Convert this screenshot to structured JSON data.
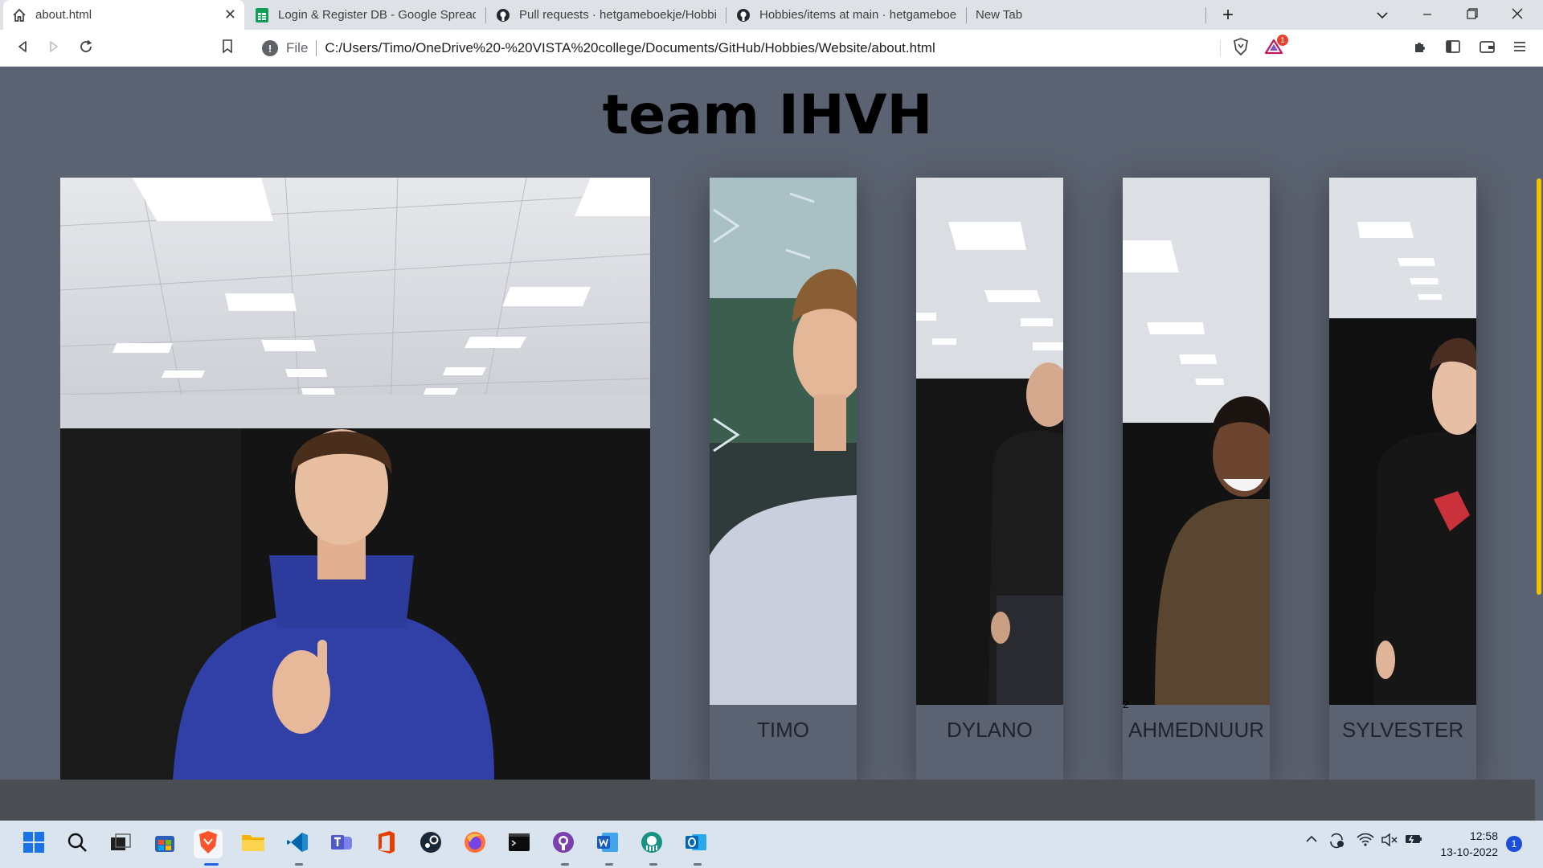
{
  "browser": {
    "tabs": [
      {
        "title": "about.html",
        "icon": "home-icon",
        "active": true
      },
      {
        "title": "Login & Register DB - Google Spreads",
        "icon": "google-sheets-icon",
        "active": false
      },
      {
        "title": "Pull requests · hetgameboekje/Hobbie",
        "icon": "github-icon",
        "active": false
      },
      {
        "title": "Hobbies/items at main · hetgameboek",
        "icon": "github-icon",
        "active": false
      },
      {
        "title": "New Tab",
        "icon": "none",
        "active": false
      }
    ],
    "new_tab_label": "+",
    "address": {
      "scheme_label": "File",
      "url": "C:/Users/Timo/OneDrive%20-%20VISTA%20college/Documents/GitHub/Hobbies/Website/about.html"
    },
    "brave_rewards_badge": "1"
  },
  "page": {
    "title": "team IHVH",
    "main_photo": {
      "subject": "person in blue hoodie giving thumbs up",
      "icon": "photo"
    },
    "members": [
      {
        "name": "TIMO",
        "number": ""
      },
      {
        "name": "DYLANO",
        "number": ""
      },
      {
        "name": "AHMEDNUUR",
        "number": "2"
      },
      {
        "name": "SYLVESTER",
        "number": ""
      }
    ]
  },
  "taskbar": {
    "apps": [
      {
        "name": "start-icon",
        "active": false
      },
      {
        "name": "search-icon",
        "active": false
      },
      {
        "name": "task-view-icon",
        "active": false
      },
      {
        "name": "store-icon",
        "active": false
      },
      {
        "name": "brave-icon",
        "active": true
      },
      {
        "name": "file-explorer-icon",
        "active": false
      },
      {
        "name": "vscode-icon",
        "active": false
      },
      {
        "name": "teams-icon",
        "active": false
      },
      {
        "name": "office-icon",
        "active": false
      },
      {
        "name": "steam-icon",
        "active": false
      },
      {
        "name": "firefox-icon",
        "active": false
      },
      {
        "name": "terminal-icon",
        "active": false
      },
      {
        "name": "github-desktop-icon",
        "active": false
      },
      {
        "name": "word-icon",
        "active": false
      },
      {
        "name": "gitkraken-icon",
        "active": false
      },
      {
        "name": "outlook-icon",
        "active": false
      }
    ],
    "time": "12:58",
    "date": "13-10-2022",
    "notification_count": "1"
  },
  "colors": {
    "page_bg": "#5b6271",
    "footer_bg": "#4a4d52",
    "scroll_thumb": "#f2c200",
    "taskbar_bg": "#d9e4ee"
  }
}
